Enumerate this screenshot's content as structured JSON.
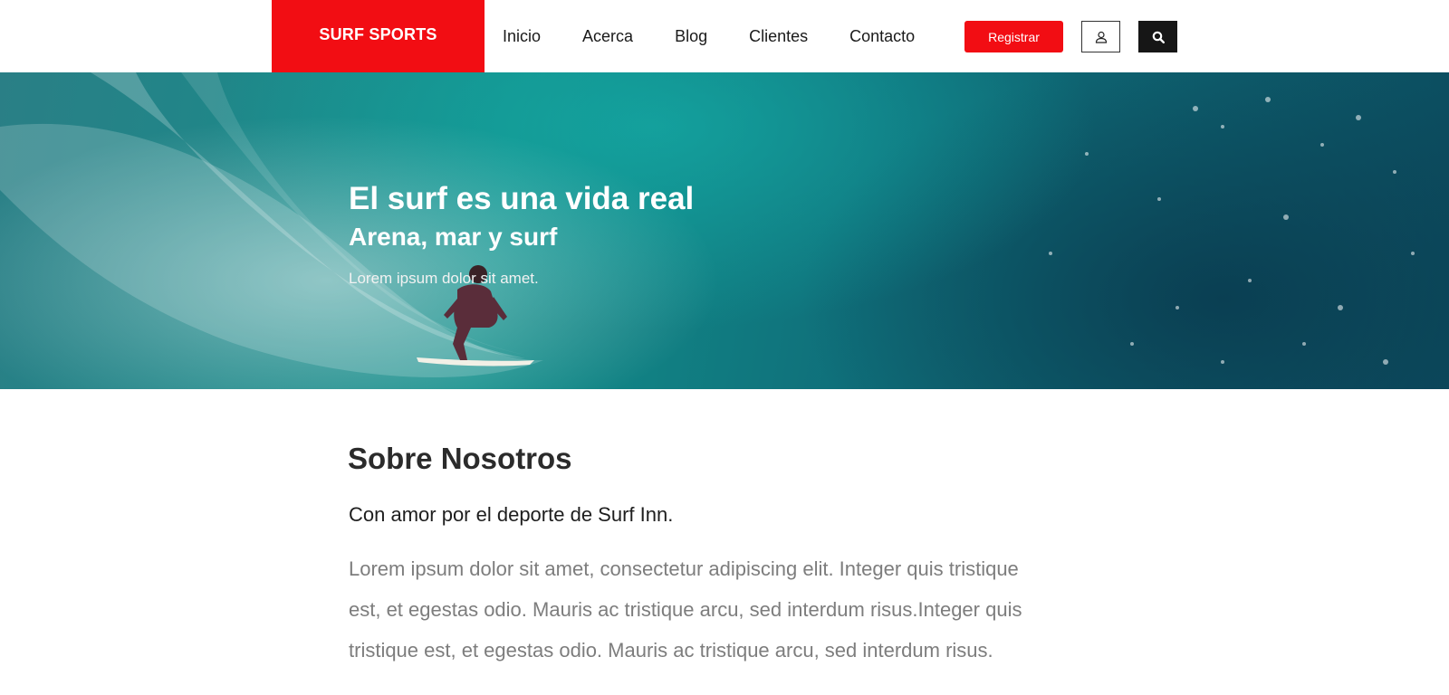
{
  "brand": {
    "name": "SURF SPORTS",
    "color": "#f20d13"
  },
  "nav": {
    "items": [
      {
        "label": "Inicio"
      },
      {
        "label": "Acerca"
      },
      {
        "label": "Blog"
      },
      {
        "label": "Clientes"
      },
      {
        "label": "Contacto"
      }
    ]
  },
  "header": {
    "register_label": "Registrar",
    "user_icon": "user-icon",
    "search_icon": "search-icon"
  },
  "hero": {
    "title": "El surf es una vida real",
    "subtitle": "Arena, mar y surf",
    "description": "Lorem ipsum dolor sit amet."
  },
  "about": {
    "heading": "Sobre Nosotros",
    "lead": "Con amor por el deporte de Surf Inn.",
    "body": "Lorem ipsum dolor sit amet, consectetur adipiscing elit. Integer quis tristique est, et egestas odio. Mauris ac tristique arcu, sed interdum risus.Integer quis tristique est, et egestas odio. Mauris ac tristique arcu, sed interdum risus."
  }
}
